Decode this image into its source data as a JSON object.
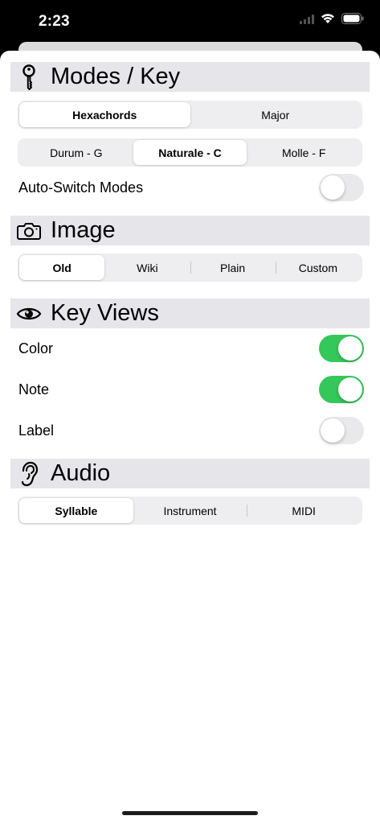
{
  "status_bar": {
    "time": "2:23"
  },
  "colors": {
    "accent_green": "#34c759",
    "header_bg": "#e5e5ea",
    "segment_bg": "#eeeef0"
  },
  "sections": {
    "modes_key": {
      "title": "Modes / Key",
      "icon": "key-icon",
      "system_segment": {
        "options": [
          "Hexachords",
          "Major"
        ],
        "selected": "Hexachords"
      },
      "key_segment": {
        "options": [
          "Durum - G",
          "Naturale - C",
          "Molle - F"
        ],
        "selected": "Naturale - C"
      },
      "auto_switch": {
        "label": "Auto-Switch Modes",
        "on": false
      }
    },
    "image": {
      "title": "Image",
      "icon": "camera-icon",
      "segment": {
        "options": [
          "Old",
          "Wiki",
          "Plain",
          "Custom"
        ],
        "selected": "Old"
      }
    },
    "key_views": {
      "title": "Key Views",
      "icon": "eye-icon",
      "rows": [
        {
          "label": "Color",
          "on": true
        },
        {
          "label": "Note",
          "on": true
        },
        {
          "label": "Label",
          "on": false
        }
      ]
    },
    "audio": {
      "title": "Audio",
      "icon": "ear-icon",
      "segment": {
        "options": [
          "Syllable",
          "Instrument",
          "MIDI"
        ],
        "selected": "Syllable"
      }
    }
  }
}
